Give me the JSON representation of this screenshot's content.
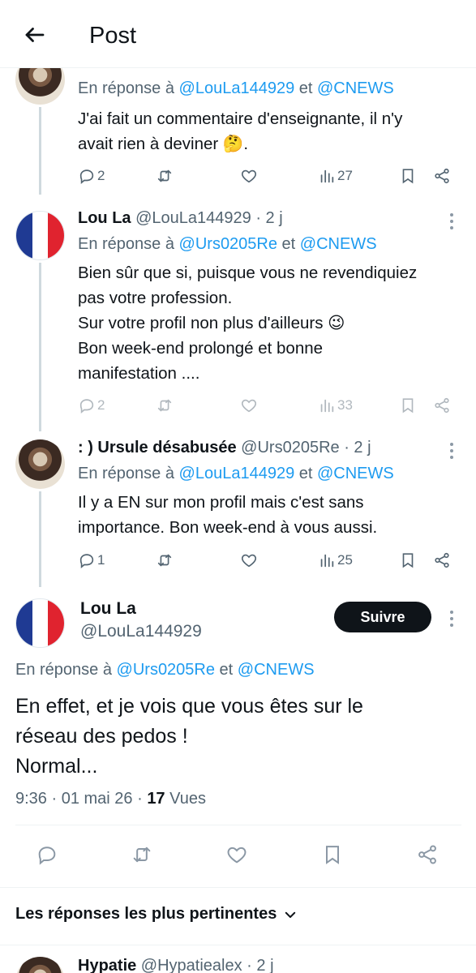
{
  "header": {
    "title": "Post"
  },
  "replies": [
    {
      "reply_prefix": "En réponse à ",
      "mention1": "@LouLa144929",
      "joiner": " et ",
      "mention2": "@CNEWS",
      "lines": [
        "J'ai fait un commentaire d'enseignante, il n'y",
        "avait rien à deviner 🤔."
      ],
      "comments": "2",
      "views": "27"
    },
    {
      "name": "Lou La",
      "handle_time": " @LouLa144929 · 2 j",
      "reply_prefix": "En réponse à ",
      "mention1": "@Urs0205Re",
      "joiner": " et ",
      "mention2": "@CNEWS",
      "lines": [
        "Bien sûr que si, puisque vous ne revendiquiez",
        "pas votre profession.",
        "Sur votre profil non plus d'ailleurs 😉",
        "Bon week-end prolongé et bonne",
        "manifestation ...."
      ],
      "comments": "2",
      "views": "33"
    },
    {
      "name": ": ) Ursule désabusée",
      "handle_time": " @Urs0205Re · 2 j",
      "reply_prefix": "En réponse à ",
      "mention1": "@LouLa144929",
      "joiner": " et ",
      "mention2": "@CNEWS",
      "lines": [
        "Il y a EN sur mon profil mais c'est sans",
        "importance. Bon week-end à vous aussi."
      ],
      "comments": "1",
      "views": "25"
    }
  ],
  "main_post": {
    "name": "Lou La",
    "handle": "@LouLa144929",
    "follow_label": "Suivre",
    "reply_prefix": "En réponse à ",
    "mention1": "@Urs0205Re",
    "joiner": " et ",
    "mention2": "@CNEWS",
    "lines": [
      "En effet, et je vois que vous êtes sur le",
      "réseau des pedos !",
      "Normal..."
    ],
    "time": "9:36 · 01 mai 26 · ",
    "views_count": "17",
    "views_label": " Vues"
  },
  "sort": {
    "label": "Les réponses les plus pertinentes"
  },
  "next_reply": {
    "name": "Hypatie",
    "handle_time": " @Hypatiealex · 2 j"
  },
  "colors": {
    "accent": "#1d9bf0",
    "muted": "#536471",
    "text": "#0f1419",
    "button_bg": "#0f1419"
  }
}
